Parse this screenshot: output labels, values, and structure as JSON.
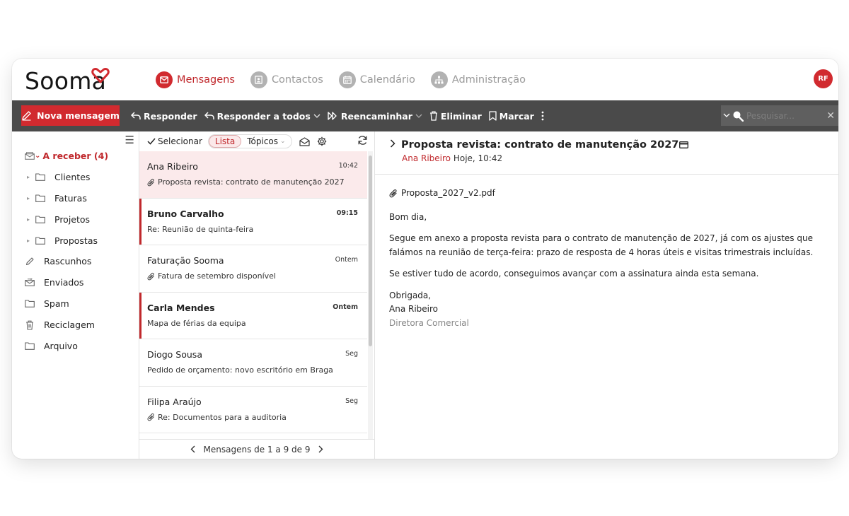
{
  "app": {
    "logo_text": "Sooma",
    "avatar_initials": "RF"
  },
  "nav": {
    "items": [
      {
        "label": "Mensagens",
        "icon": "envelope-icon",
        "active": true
      },
      {
        "label": "Contactos",
        "icon": "contacts-icon",
        "active": false
      },
      {
        "label": "Calendário",
        "icon": "calendar-icon",
        "active": false
      },
      {
        "label": "Administração",
        "icon": "admin-icon",
        "active": false
      }
    ]
  },
  "toolbar": {
    "new_message": "Nova mensagem",
    "reply": "Responder",
    "reply_all": "Responder a todos",
    "forward": "Reencaminhar",
    "delete": "Eliminar",
    "mark": "Marcar",
    "search_placeholder": "Pesquisar..."
  },
  "sidebar": {
    "inbox": {
      "label": "A receber",
      "count": "(4)"
    },
    "subfolders": [
      "Clientes",
      "Faturas",
      "Projetos",
      "Propostas"
    ],
    "folders": [
      {
        "label": "Rascunhos",
        "icon": "pencil-icon"
      },
      {
        "label": "Enviados",
        "icon": "sent-icon"
      },
      {
        "label": "Spam",
        "icon": "folder-icon"
      },
      {
        "label": "Reciclagem",
        "icon": "trash-icon"
      },
      {
        "label": "Arquivo",
        "icon": "folder-icon"
      }
    ]
  },
  "list": {
    "select_label": "Selecionar",
    "view_list": "Lista",
    "view_topics": "Tópicos",
    "pager_text": "Mensagens de 1 a 9 de 9",
    "messages": [
      {
        "from": "Ana Ribeiro",
        "time": "10:42",
        "subject": "Proposta revista: contrato de manutenção 2027",
        "attachment": true,
        "unread": false,
        "selected": true
      },
      {
        "from": "Bruno Carvalho",
        "time": "09:15",
        "subject": "Re: Reunião de quinta-feira",
        "attachment": false,
        "unread": true,
        "selected": false
      },
      {
        "from": "Faturação Sooma",
        "time": "Ontem",
        "subject": "Fatura de setembro disponível",
        "attachment": true,
        "unread": false,
        "selected": false
      },
      {
        "from": "Carla Mendes",
        "time": "Ontem",
        "subject": "Mapa de férias da equipa",
        "attachment": false,
        "unread": true,
        "selected": false
      },
      {
        "from": "Diogo Sousa",
        "time": "Seg",
        "subject": "Pedido de orçamento: novo escritório em Braga",
        "attachment": false,
        "unread": false,
        "selected": false
      },
      {
        "from": "Filipa Araújo",
        "time": "Seg",
        "subject": "Re: Documentos para a auditoria",
        "attachment": true,
        "unread": false,
        "selected": false
      }
    ]
  },
  "reader": {
    "subject": "Proposta revista: contrato de manutenção 2027",
    "from": "Ana Ribeiro",
    "date": "Hoje, 10:42",
    "attachment_name": "Proposta_2027_v2.pdf",
    "greeting": "Bom dia,",
    "paragraph1": "Segue em anexo a proposta revista para o contrato de manutenção de 2027, já com os ajustes que falámos na reunião de terça-feira: prazo de resposta de 4 horas úteis e visitas trimestrais incluídas.",
    "paragraph2": "Se estiver tudo de acordo, conseguimos avançar com a assinatura ainda esta semana.",
    "closing": "Obrigada,",
    "signature_name": "Ana Ribeiro",
    "signature_title": "Diretora Comercial"
  },
  "colors": {
    "accent": "#d12a2f",
    "toolbar": "#4a4a4a",
    "selected_row": "#fbeaeb"
  }
}
